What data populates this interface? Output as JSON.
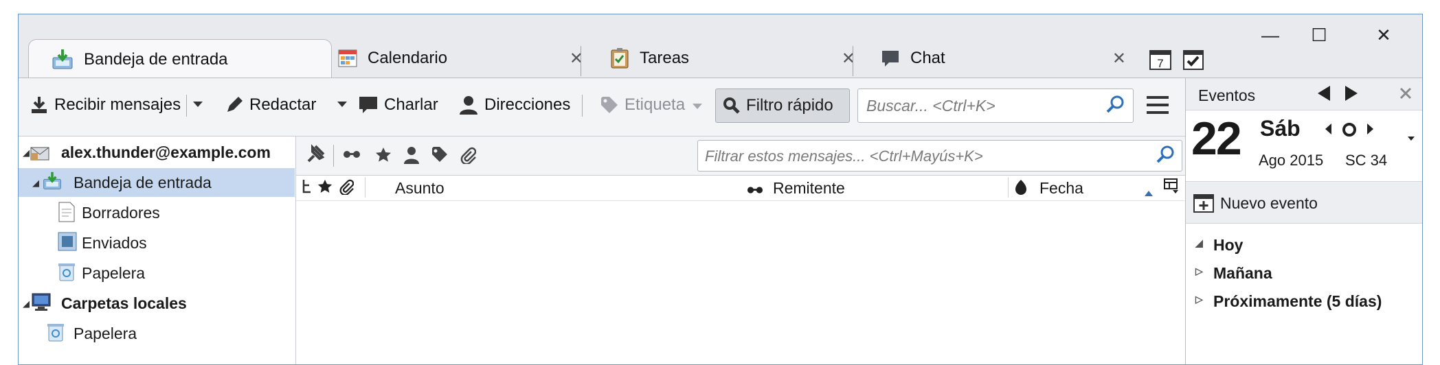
{
  "window": {
    "minimize_glyph": "—",
    "maximize_glyph": "☐",
    "close_glyph": "✕"
  },
  "tabs": [
    {
      "label": "Bandeja de entrada",
      "icon": "inbox-icon",
      "active": true
    },
    {
      "label": "Calendario",
      "icon": "calendar-icon",
      "close": "✕"
    },
    {
      "label": "Tareas",
      "icon": "tasks-icon",
      "close": "✕"
    },
    {
      "label": "Chat",
      "icon": "chat-icon",
      "close": "✕"
    }
  ],
  "tab_extra": {
    "calendar_day": "7"
  },
  "toolbar": {
    "get_messages": "Recibir mensajes",
    "write": "Redactar",
    "chat": "Charlar",
    "address_book": "Direcciones",
    "tag": "Etiqueta",
    "quick_filter": "Filtro rápido",
    "search_placeholder": "Buscar... <Ctrl+K>"
  },
  "folders": [
    {
      "label": "alex.thunder@example.com",
      "bold": true,
      "level": 0,
      "twisty": "◢",
      "icon": "account-icon"
    },
    {
      "label": "Bandeja de entrada",
      "bold": false,
      "level": 1,
      "twisty": "◢",
      "icon": "inbox-icon",
      "selected": true
    },
    {
      "label": "Borradores",
      "bold": false,
      "level": 2,
      "icon": "drafts-icon"
    },
    {
      "label": "Enviados",
      "bold": false,
      "level": 2,
      "icon": "sent-icon"
    },
    {
      "label": "Papelera",
      "bold": false,
      "level": 2,
      "icon": "trash-icon"
    },
    {
      "label": "Carpetas locales",
      "bold": true,
      "level": 0,
      "twisty": "◢",
      "icon": "local-folders-icon"
    },
    {
      "label": "Papelera",
      "bold": false,
      "level": 1,
      "icon": "trash-icon"
    }
  ],
  "quickfilter": {
    "placeholder": "Filtrar estos mensajes... <Ctrl+Mayús+K>"
  },
  "columns": {
    "subject": "Asunto",
    "sender": "Remitente",
    "date": "Fecha"
  },
  "events": {
    "title": "Eventos",
    "day_number": "22",
    "day_name": "Sáb",
    "month_year": "Ago 2015",
    "week": "SC 34",
    "new_event": "Nuevo evento",
    "groups": [
      {
        "label": "Hoy",
        "twisty": "◢"
      },
      {
        "label": "Mañana",
        "twisty": "▷"
      },
      {
        "label": "Próximamente (5 días)",
        "twisty": "▷"
      }
    ]
  }
}
